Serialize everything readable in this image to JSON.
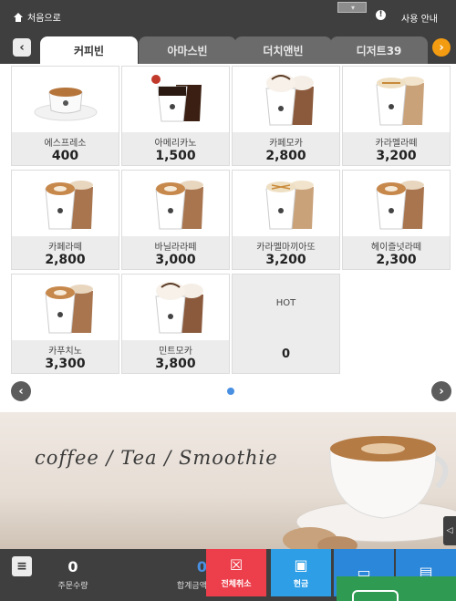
{
  "topbar": {
    "home_label": "처음으로",
    "language": "",
    "help_label": "사용 안내",
    "icons": {
      "home": "home-icon",
      "info": "info-icon"
    }
  },
  "tabs": [
    {
      "label": "커피빈"
    },
    {
      "label": "아마스빈"
    },
    {
      "label": "더치앤빈"
    },
    {
      "label": "디저트39"
    }
  ],
  "menu": [
    {
      "name": "에스프레소",
      "price": "400"
    },
    {
      "name": "아메리카노",
      "price": "1,500"
    },
    {
      "name": "카페모카",
      "price": "2,800"
    },
    {
      "name": "카라멜라떼",
      "price": "3,200"
    },
    {
      "name": "카페라떼",
      "price": "2,800"
    },
    {
      "name": "바닐라라떼",
      "price": "3,000"
    },
    {
      "name": "카라멜마끼아또",
      "price": "3,200"
    },
    {
      "name": "헤이즐넛라떼",
      "price": "2,300"
    },
    {
      "name": "카푸치노",
      "price": "3,300"
    },
    {
      "name": "민트모카",
      "price": "3,800"
    }
  ],
  "hot_item": {
    "label": "HOT",
    "price": "0"
  },
  "banner": {
    "text": "coffee / Tea / Smoothie"
  },
  "bottom": {
    "order_count": "0",
    "order_count_label": "주문수량",
    "total": "0",
    "total_label": "합계금액",
    "cancel_all_label": "전체취소",
    "cash_label": "현금"
  },
  "colors": {
    "topbar": "#3f3f3f",
    "accent_orange": "#f39c12",
    "cancel_red": "#ec3f4b",
    "pay_blue": "#2e9ee6",
    "green": "#2f9b52"
  }
}
